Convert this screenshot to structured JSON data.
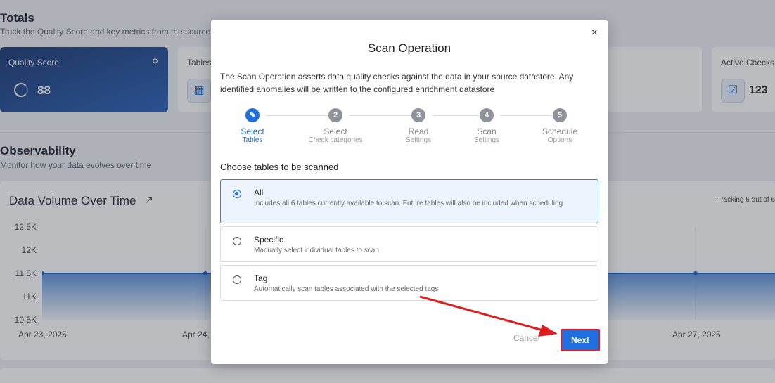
{
  "page": {
    "totals_title": "Totals",
    "totals_subtitle": "Track the Quality Score and key metrics from the source",
    "observability_title": "Observability",
    "observability_subtitle": "Monitor how your data evolves over time"
  },
  "metrics": {
    "quality_score_label": "Quality Score",
    "quality_score_value": "88",
    "tables_label": "Tables",
    "active_checks_label": "Active Checks",
    "active_checks_value": "123"
  },
  "chart_data": {
    "type": "area",
    "title": "Data Volume Over Time",
    "tracking_text": "Tracking 6 out of 6",
    "y_ticks": [
      "12.5K",
      "12K",
      "11.5K",
      "11K",
      "10.5K"
    ],
    "x_ticks": [
      "Apr 23, 2025",
      "Apr 24, 2",
      "Apr 27, 2025"
    ],
    "ylim": [
      10500,
      12500
    ],
    "series": [
      {
        "values": [
          11500,
          11500,
          11500,
          11500,
          11500
        ]
      }
    ]
  },
  "modal": {
    "title": "Scan Operation",
    "description": "The Scan Operation asserts data quality checks against the data in your source datastore. Any identified anomalies will be written to the configured enrichment datastore",
    "close_symbol": "×",
    "steps": [
      {
        "number": "",
        "label": "Select",
        "sub": "Tables",
        "active": true
      },
      {
        "number": "2",
        "label": "Select",
        "sub": "Check categories",
        "active": false
      },
      {
        "number": "3",
        "label": "Read",
        "sub": "Settings",
        "active": false
      },
      {
        "number": "4",
        "label": "Scan",
        "sub": "Settings",
        "active": false
      },
      {
        "number": "5",
        "label": "Schedule",
        "sub": "Options",
        "active": false
      }
    ],
    "choose_label": "Choose tables to be scanned",
    "options": [
      {
        "title": "All",
        "description": "Includes all 6 tables currently available to scan. Future tables will also be included when scheduling",
        "selected": true
      },
      {
        "title": "Specific",
        "description": "Manually select individual tables to scan",
        "selected": false
      },
      {
        "title": "Tag",
        "description": "Automatically scan tables associated with the selected tags",
        "selected": false
      }
    ],
    "cancel_label": "Cancel",
    "next_label": "Next"
  },
  "colors": {
    "primary": "#1f6fe0",
    "highlight_border": "#e01d1d"
  }
}
